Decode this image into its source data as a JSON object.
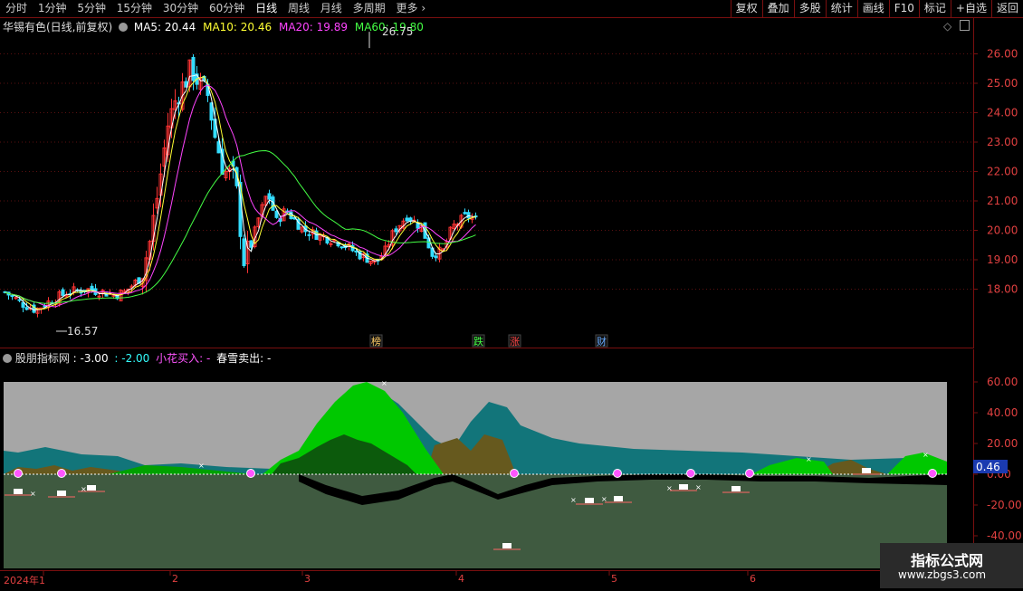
{
  "toolbar": {
    "timeframes": [
      "分时",
      "1分钟",
      "5分钟",
      "15分钟",
      "30分钟",
      "60分钟",
      "日线",
      "周线",
      "月线",
      "多周期",
      "更多"
    ],
    "active_timeframe": "日线",
    "right_tools": [
      "复权",
      "叠加",
      "多股",
      "统计",
      "画线",
      "F10",
      "标记",
      "+自选",
      "返回"
    ]
  },
  "price_panel": {
    "stock_title": "华锡有色(日线,前复权)",
    "ma": [
      {
        "label": "MA5: 20.44",
        "color": "#ffffff"
      },
      {
        "label": "MA10: 20.46",
        "color": "#ffff33"
      },
      {
        "label": "MA20: 19.89",
        "color": "#ff44ff"
      },
      {
        "label": "MA60: 19.80",
        "color": "#44ff44"
      }
    ],
    "high_label": "26.75",
    "low_label": "16.57",
    "event_tags": [
      {
        "text": "榜",
        "color": "#ffcc66"
      },
      {
        "text": "跌",
        "color": "#44ff44"
      },
      {
        "text": "涨",
        "color": "#ff4444"
      },
      {
        "text": "财",
        "color": "#66aaff"
      }
    ],
    "y_axis": [
      "26.00",
      "25.00",
      "24.00",
      "23.00",
      "22.00",
      "21.00",
      "20.00",
      "19.00",
      "18.00"
    ]
  },
  "indicator_panel": {
    "name": "股朋指标网",
    "values": [
      {
        "label": ": -3.00",
        "color": "#ffffff"
      },
      {
        "label": ": -2.00",
        "color": "#33ffff"
      },
      {
        "label": "小花买入: -",
        "color": "#ff55ff"
      },
      {
        "label": "春雪卖出: -",
        "color": "#ffffff"
      }
    ],
    "current_value": "0.46",
    "y_axis": [
      "60.00",
      "40.00",
      "20.00",
      "0.00",
      "-20.00",
      "-40.00"
    ]
  },
  "date_axis": [
    "2024年1",
    "2",
    "3",
    "4",
    "5",
    "6"
  ],
  "watermark": {
    "title": "指标公式网",
    "url": "www.zbgs3.com"
  },
  "colors": {
    "up": "#ff3333",
    "down": "#33ddff",
    "grid": "#7a0f0f"
  }
}
